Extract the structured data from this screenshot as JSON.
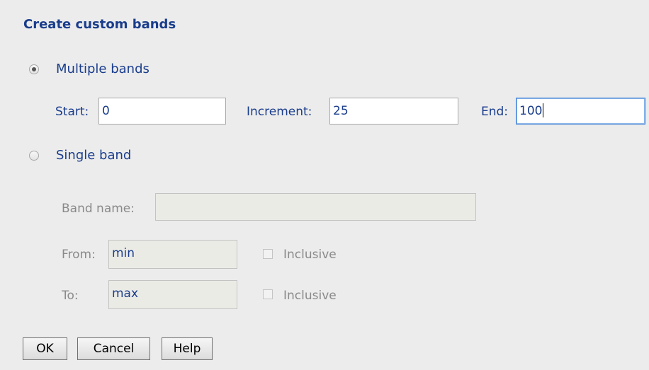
{
  "dialog": {
    "title": "Create custom bands"
  },
  "multiple": {
    "label": "Multiple bands",
    "selected": true,
    "start_label": "Start:",
    "start_value": "0",
    "increment_label": "Increment:",
    "increment_value": "25",
    "end_label": "End:",
    "end_value": "100"
  },
  "single": {
    "label": "Single band",
    "selected": false,
    "band_name_label": "Band name:",
    "band_name_value": "",
    "from_label": "From:",
    "from_value": "min",
    "from_inclusive_label": "Inclusive",
    "to_label": "To:",
    "to_value": "max",
    "to_inclusive_label": "Inclusive"
  },
  "buttons": {
    "ok": "OK",
    "cancel": "Cancel",
    "help": "Help"
  }
}
